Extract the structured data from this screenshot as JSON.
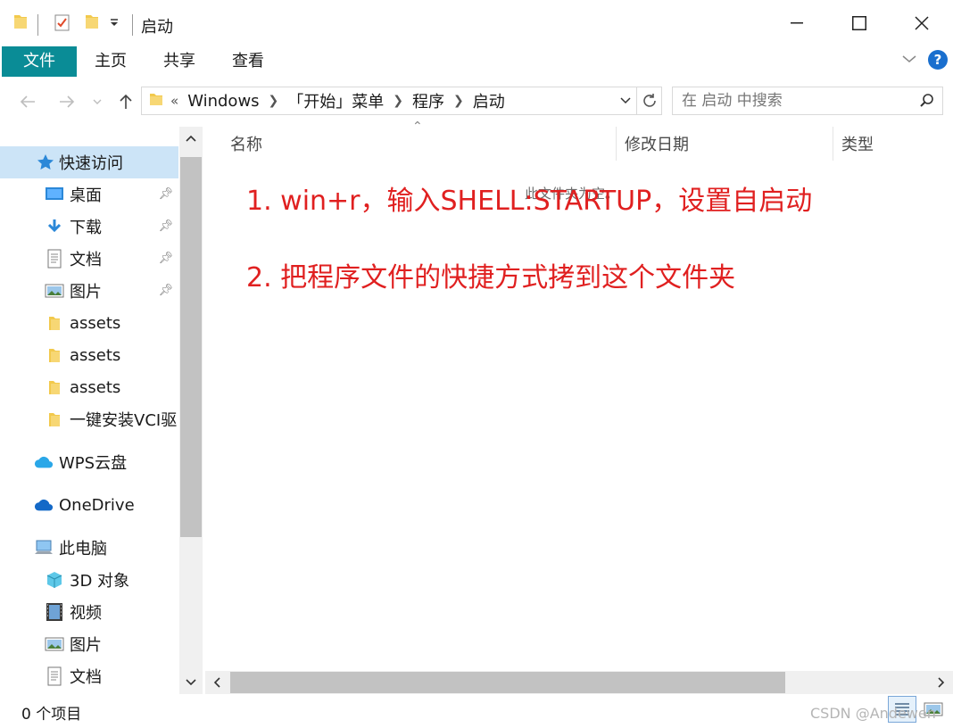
{
  "window": {
    "title": "启动",
    "colors": {
      "accent": "#0a8c96",
      "selection": "#cce4f7",
      "annotation": "#e02020"
    }
  },
  "ribbon": {
    "tabs": [
      {
        "label": "文件",
        "active": true
      },
      {
        "label": "主页"
      },
      {
        "label": "共享"
      },
      {
        "label": "查看"
      }
    ],
    "help_label": "?"
  },
  "address": {
    "overflow": "«",
    "crumbs": [
      "Windows",
      "「开始」菜单",
      "程序",
      "启动"
    ]
  },
  "search": {
    "placeholder": "在 启动 中搜索"
  },
  "nav": {
    "quick_access": {
      "label": "快速访问"
    },
    "items": [
      {
        "label": "桌面",
        "pinned": true,
        "icon": "desktop-icon"
      },
      {
        "label": "下载",
        "pinned": true,
        "icon": "download-icon"
      },
      {
        "label": "文档",
        "pinned": true,
        "icon": "document-icon"
      },
      {
        "label": "图片",
        "pinned": true,
        "icon": "pictures-icon"
      },
      {
        "label": "assets",
        "icon": "folder-icon"
      },
      {
        "label": "assets",
        "icon": "folder-icon"
      },
      {
        "label": "assets",
        "icon": "folder-icon"
      },
      {
        "label": "一键安装VCI驱",
        "icon": "folder-icon"
      }
    ],
    "wps": {
      "label": "WPS云盘"
    },
    "onedrive": {
      "label": "OneDrive"
    },
    "this_pc": {
      "label": "此电脑"
    },
    "pc_items": [
      {
        "label": "3D 对象",
        "icon": "3d-objects-icon"
      },
      {
        "label": "视频",
        "icon": "video-icon"
      },
      {
        "label": "图片",
        "icon": "pictures-icon"
      },
      {
        "label": "文档",
        "icon": "document-icon"
      }
    ]
  },
  "columns": {
    "name": "名称",
    "modified": "修改日期",
    "type": "类型"
  },
  "content": {
    "empty_message": "此文件夹为空。",
    "annotations": [
      "1. win+r，输入SHELL:STARTUP，设置自启动",
      "2. 把程序文件的快捷方式拷到这个文件夹"
    ]
  },
  "status": {
    "item_count": "0 个项目"
  },
  "watermark": "CSDN @Andewen"
}
